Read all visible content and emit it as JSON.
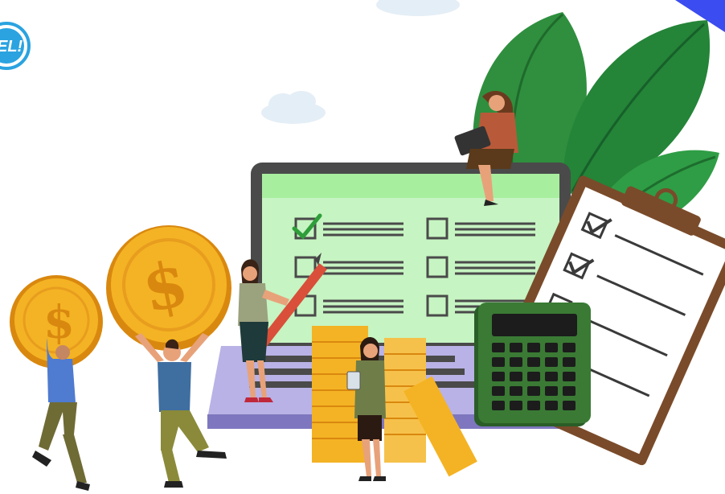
{
  "logo": {
    "text": "EL!"
  },
  "coins": {
    "symbol": "$"
  },
  "checklist": {
    "screen_rows": [
      {
        "left_checked": true,
        "right_checked": false
      },
      {
        "left_checked": false,
        "right_checked": false
      },
      {
        "left_checked": false,
        "right_checked": false
      }
    ],
    "clipboard_rows": [
      {
        "checked": true
      },
      {
        "checked": true
      },
      {
        "checked": false
      },
      {
        "checked": false
      }
    ]
  },
  "colors": {
    "accent_green": "#2f9e3a",
    "screen_green": "#c6f4c2",
    "coin_gold": "#f4b324",
    "laptop_frame": "#4a4a4a",
    "keyboard_lilac": "#b8b2e6",
    "calculator": "#3a7a34",
    "leaf_green": "#2f8f3e",
    "clipboard_brown": "#7a4b2a"
  },
  "icons": [
    "logo-badge",
    "coin-dollar-icon",
    "checkbox-icon",
    "checkmark-icon",
    "calculator-icon",
    "clipboard-icon",
    "pencil-icon",
    "leaf-icon",
    "cloud-icon"
  ]
}
